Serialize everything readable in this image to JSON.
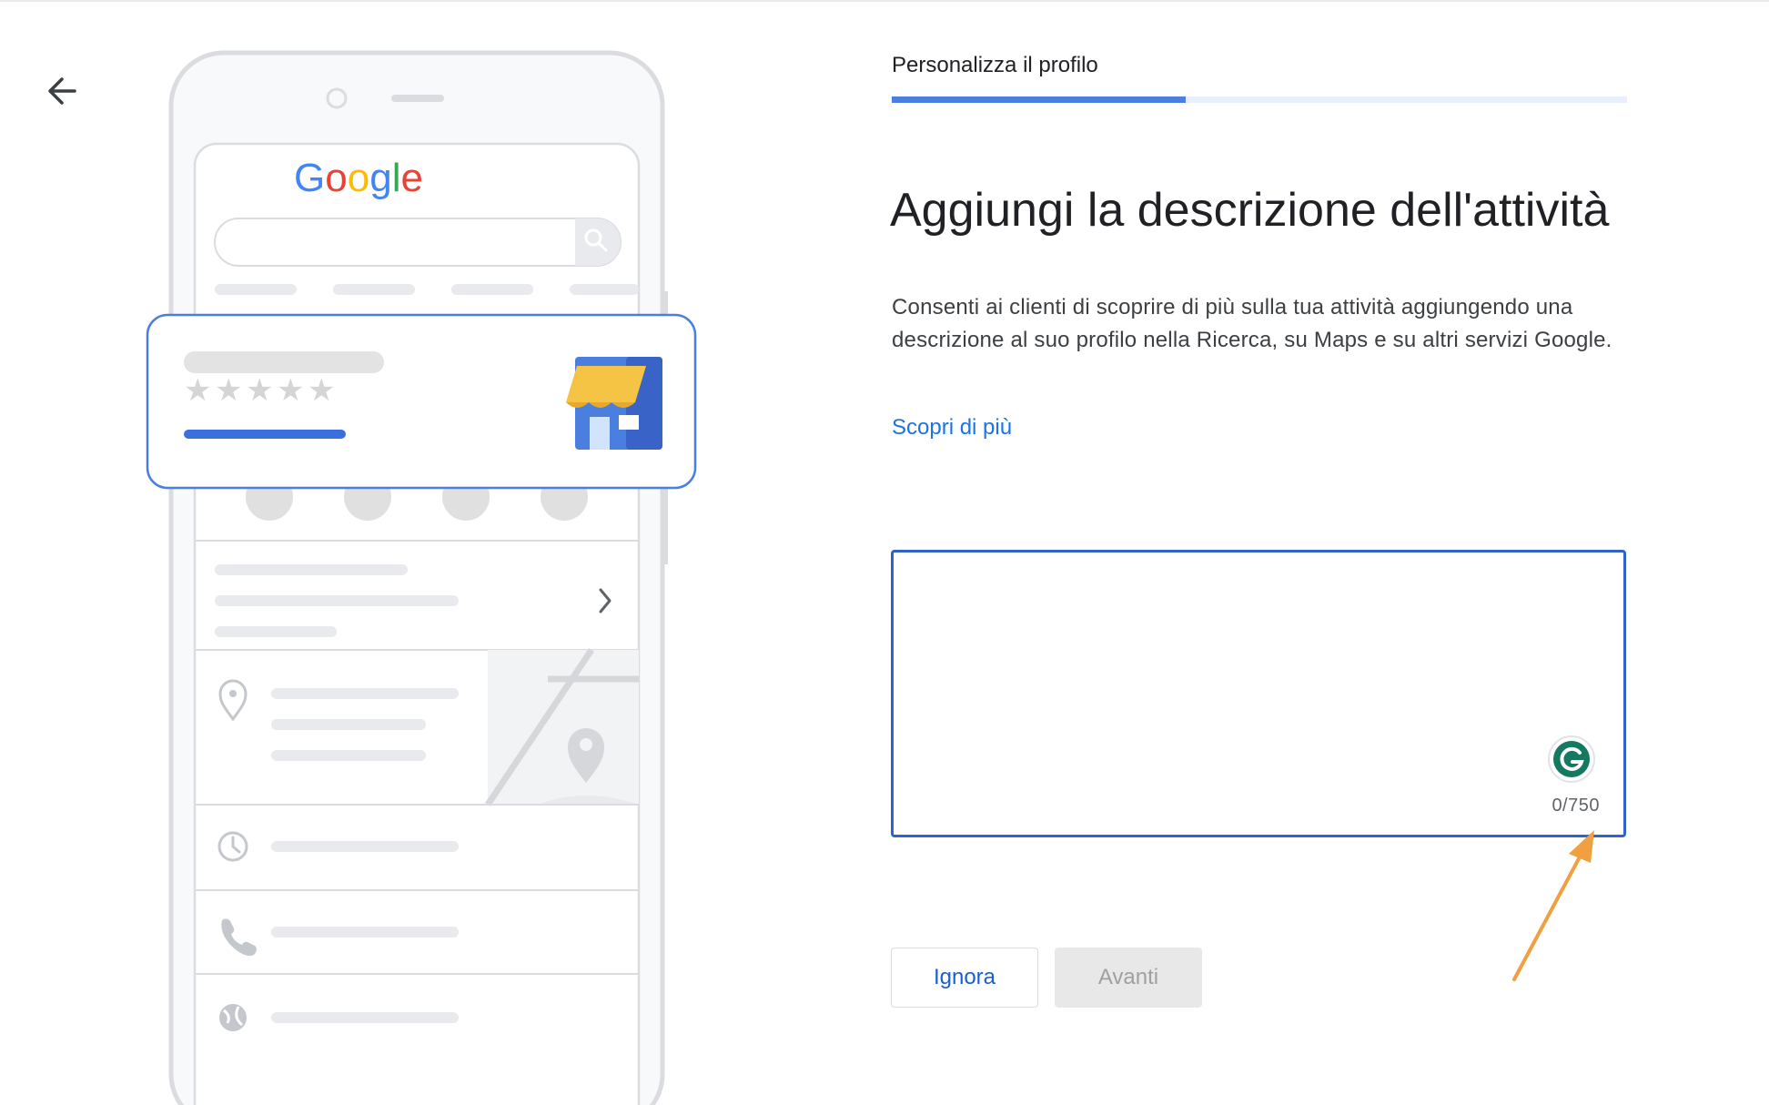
{
  "header": {
    "back_icon": "arrow-back-icon",
    "step_label": "Personalizza il profilo",
    "progress_fraction": 0.4
  },
  "illustration": {
    "search_brand": "Google",
    "search_icon": "search-icon",
    "star_count": 5,
    "store_icon": "storefront-icon",
    "action_icons": [
      "phone-icon",
      "directions-icon",
      "bookmark-icon",
      "globe-icon"
    ],
    "row_icons": [
      "chevron-right-icon",
      "location-pin-icon",
      "map-pin-icon",
      "clock-icon",
      "phone-icon",
      "globe-icon"
    ]
  },
  "main": {
    "title": "Aggiungi la descrizione dell'attività",
    "description": "Consenti ai clienti di scoprire di più sulla tua attività aggiungendo una descrizione al suo profilo nella Ricerca, su Maps e su altri servizi Google.",
    "learn_more": "Scopri di più"
  },
  "editor": {
    "value": "",
    "counter": "0/750",
    "grammarly_icon": "grammarly-icon"
  },
  "annotation": {
    "icon": "annotation-arrow-icon",
    "color": "#f0a040"
  },
  "actions": {
    "ignore_label": "Ignora",
    "next_label": "Avanti"
  },
  "colors": {
    "accent": "#1a73e8",
    "progress": "#4a7fe0",
    "input_border": "#2f63c9",
    "disabled_bg": "#e8e8e8"
  }
}
